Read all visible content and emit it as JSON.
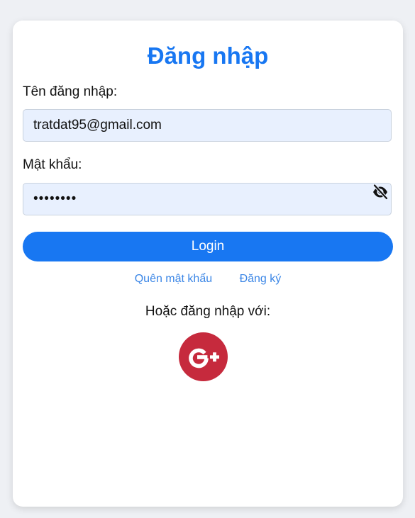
{
  "title": "Đăng nhập",
  "username": {
    "label": "Tên đăng nhập:",
    "value": "tratdat95@gmail.com"
  },
  "password": {
    "label": "Mật khẩu:",
    "value": "tratdat1",
    "toggle_icon": "eye-slash-icon"
  },
  "login_button": "Login",
  "links": {
    "forgot": "Quên mật khẩu",
    "register": "Đăng ký"
  },
  "social": {
    "text": "Hoặc đăng nhập với:",
    "google_icon": "google-plus-icon"
  },
  "colors": {
    "accent": "#1877f2",
    "link": "#3b86e6",
    "google": "#c62a3d",
    "input_bg": "#e8f0fe",
    "page_bg": "#eef0f4"
  }
}
